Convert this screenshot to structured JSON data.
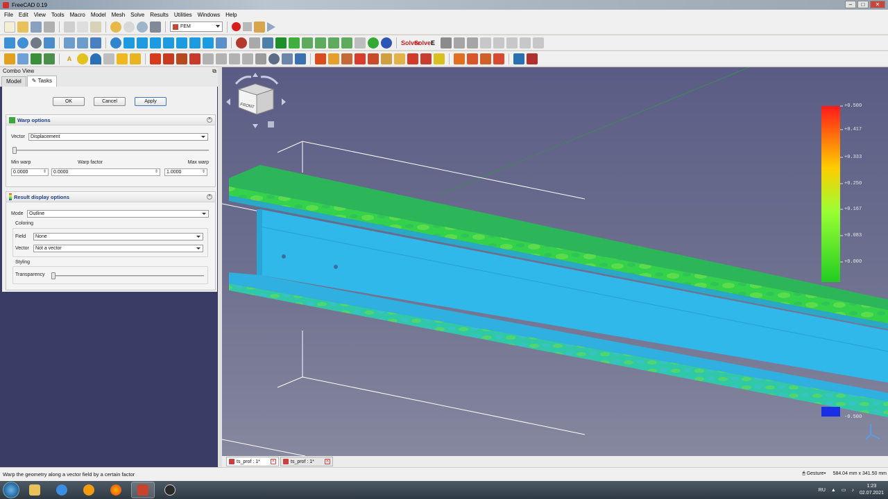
{
  "window": {
    "title": "FreeCAD 0.19",
    "controls": [
      "minimize-icon",
      "maximize-icon",
      "close-icon"
    ]
  },
  "menu": [
    "File",
    "Edit",
    "View",
    "Tools",
    "Macro",
    "Model",
    "Mesh",
    "Solve",
    "Results",
    "Utilities",
    "Windows",
    "Help"
  ],
  "toolbar": {
    "workbench": "FEM",
    "solver_labels": [
      "Solver",
      "Solver",
      "E"
    ]
  },
  "combo_view": {
    "title": "Combo View",
    "tabs": [
      "Model",
      "Tasks"
    ],
    "active_tab": "Tasks"
  },
  "task": {
    "buttons": {
      "ok": "OK",
      "cancel": "Cancel",
      "apply": "Apply"
    },
    "warp": {
      "title": "Warp options",
      "vector_label": "Vector",
      "vector_value": "Displacement",
      "min_warp_label": "Min warp",
      "warp_factor_label": "Warp factor",
      "max_warp_label": "Max warp",
      "min_warp": "0.0000",
      "warp_factor": "0.0000",
      "max_warp": "1.0000",
      "slider_position": 0.0
    },
    "result": {
      "title": "Result display options",
      "mode_label": "Mode",
      "mode_value": "Outline",
      "coloring_label": "Coloring",
      "field_label": "Field",
      "field_value": "None",
      "vector_label": "Vector",
      "vector_value": "Not a vector",
      "styling_label": "Styling",
      "transparency_label": "Transparency",
      "transparency_value": 0.0
    }
  },
  "viewport": {
    "navcube_face": "FRONT",
    "navcube_side": "LEFT",
    "legend": [
      "+0.500",
      "+0.417",
      "+0.333",
      "+0.250",
      "+0.167",
      "+0.083",
      "+0.000",
      "-0.500"
    ],
    "colors": {
      "beam_green": "#3ccf4e",
      "beam_blue": "#2fb6e8",
      "background_top": "#5a5c85"
    }
  },
  "doc_tabs": [
    {
      "label": "ts_prof : 1*",
      "active": true
    },
    {
      "label": "ts_prof : 1*",
      "active": false
    }
  ],
  "status": {
    "message": "Warp the geometry along a vector field by a certain factor",
    "nav_style": "Gesture",
    "dimensions": "584.04 mm x 341.50 mm"
  },
  "taskbar": {
    "apps": [
      "start",
      "explorer",
      "ie",
      "avast",
      "firefox",
      "freecad",
      "obs"
    ],
    "lang": "RU",
    "time": "1:23",
    "date": "02.07.2021"
  }
}
